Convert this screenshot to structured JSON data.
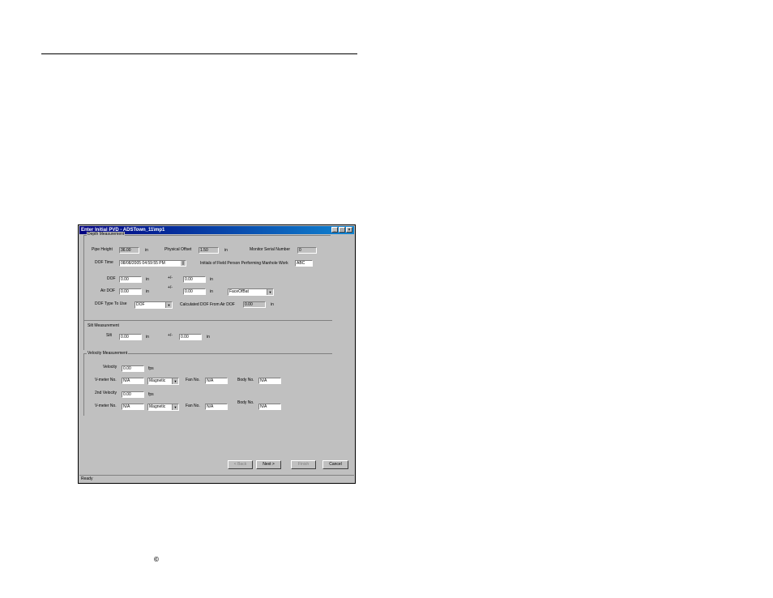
{
  "window": {
    "title": "Enter Initial PVD - ADSTown_11\\mp1"
  },
  "depth": {
    "group_label": "Depth Measurement",
    "pipe_height_label": "Pipe Height",
    "pipe_height_value": "36.00",
    "unit_in": "in",
    "physical_offset_label": "Physical Offset",
    "physical_offset_value": "1.50",
    "monitor_serial_label": "Monitor Serial Number",
    "monitor_serial_value": "0",
    "dof_time_label": "DOF Time",
    "dof_time_value": "08/08/2005 04:59:55 PM",
    "initials_label": "Initials of Field Person  Performing Manhole Work",
    "initials_value": "ABC",
    "dof_label": "DOF",
    "dof_value": "0.00",
    "pm_label": "+/-",
    "dof_pm_value": "0.00",
    "air_dof_label": "Air DOF",
    "air_dof_value": "0.00",
    "air_dof_pm_value": "0.00",
    "face_select": "FaceOfBat",
    "dof_type_label": "DOF Type To Use",
    "dof_type_select": "DOF",
    "calc_label": "Calculated DOF From Air DOF",
    "calc_value": "0.00"
  },
  "silt": {
    "group_label": "Silt Measurement",
    "silt_label": "Silt",
    "silt_value": "0.00",
    "pm_label": "+/-",
    "silt_pm_value": "0.00",
    "unit_in": "in"
  },
  "velocity": {
    "group_label": "Velocity Measurement",
    "velocity_label": "Velocity",
    "velocity_value": "0.00",
    "unit_fps": "fps",
    "vmeter_label": "V-meter No.",
    "vmeter_value": "N/A",
    "meter_type": "Magnetic",
    "fan_label": "Fan No.",
    "fan_value": "N/A",
    "body_label": "Body No.",
    "body_value": "N/A",
    "velocity2_label": "2nd Velocity",
    "velocity2_value": "0.00",
    "vmeter2_value": "N/A",
    "meter2_type": "Magnetic",
    "fan2_value": "N/A",
    "body2_value": "N/A"
  },
  "buttons": {
    "back": "< Back",
    "next": "Next >",
    "finish": "Finish",
    "cancel": "Cancel"
  },
  "status": "Ready",
  "footer_mark": "©"
}
